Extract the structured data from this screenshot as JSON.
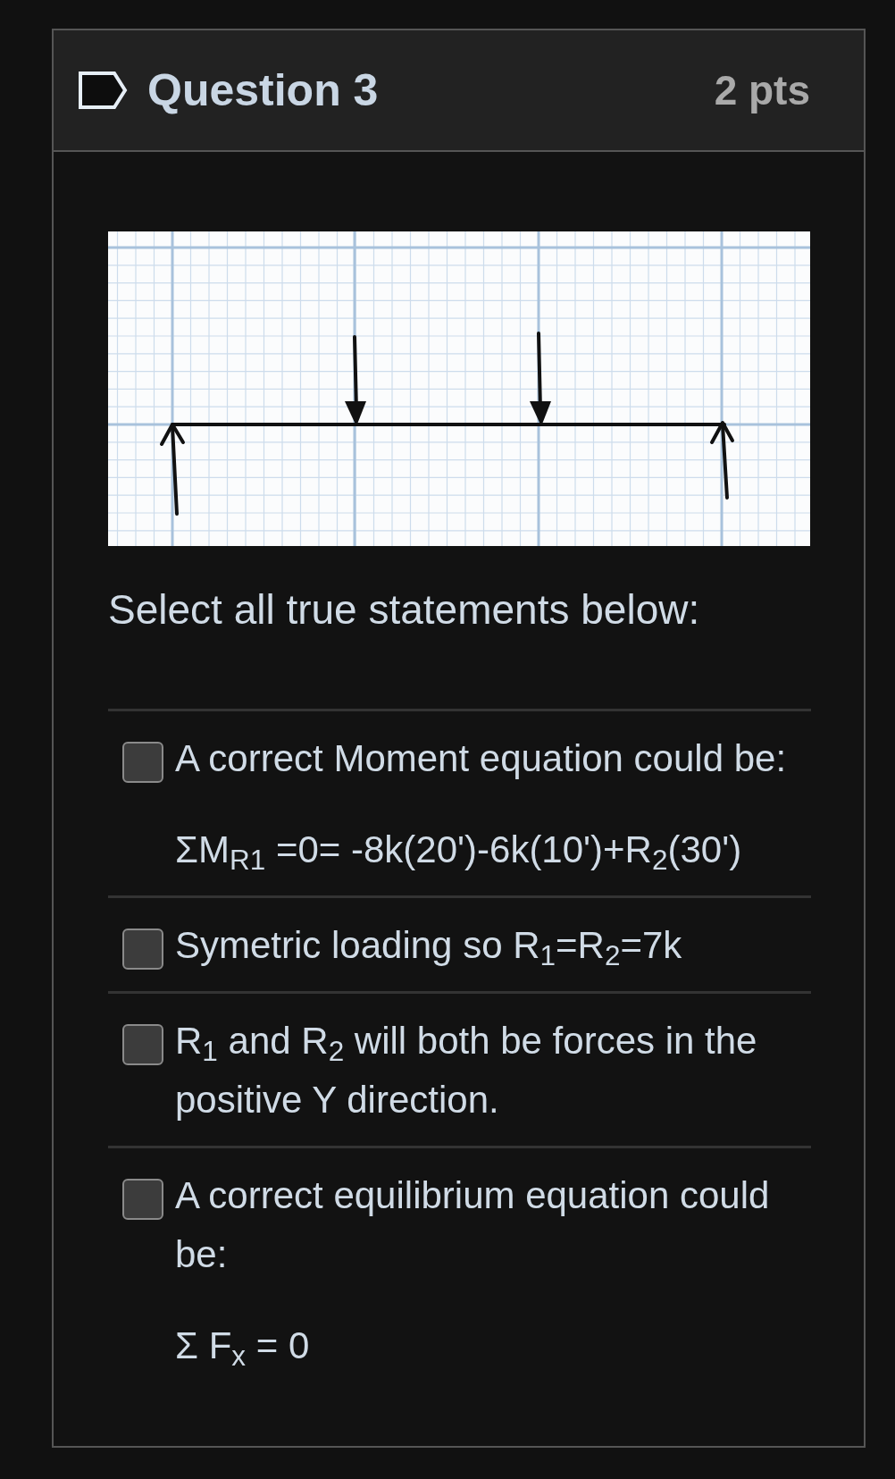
{
  "question": {
    "title": "Question 3",
    "points": "2 pts"
  },
  "prompt": "Select all true statements below:",
  "answers": [
    {
      "text": "A correct Moment equation could be:",
      "equation": "ΣM$_{R1}$ =0= -8k(20')-6k(10')+R$_{2}$(30')",
      "checked": false
    },
    {
      "text": "Symetric loading so R$_{1}$=R$_{2}$=7k",
      "checked": false
    },
    {
      "text": "R$_{1}$ and R$_{2}$ will both be forces in the positive Y direction.",
      "checked": false
    },
    {
      "text": "A correct equilibrium equation could be:",
      "equation": "Σ F$_{x}$ = 0",
      "checked": false
    }
  ]
}
